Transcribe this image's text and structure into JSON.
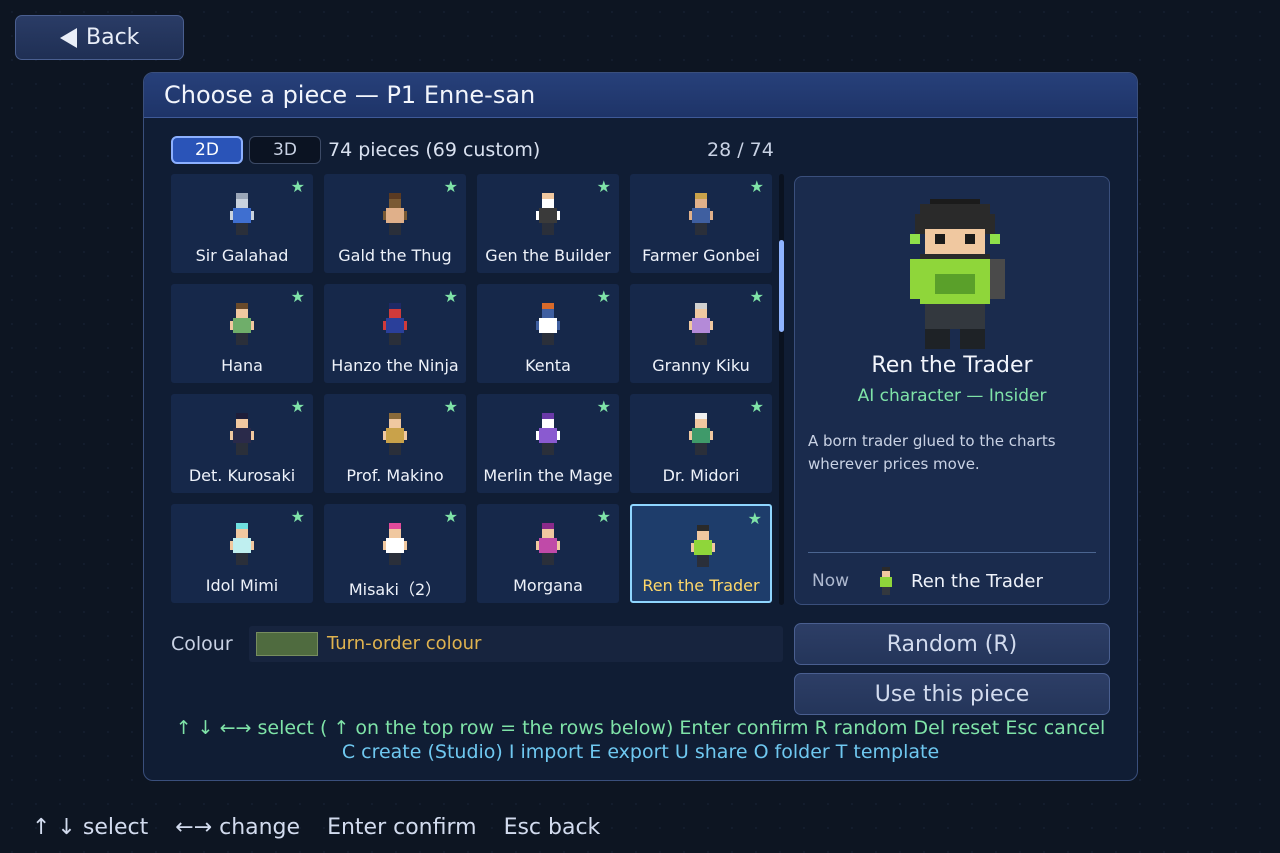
{
  "back_button": {
    "label": "Back"
  },
  "panel": {
    "title": "Choose a piece — P1 Enne-san",
    "modes": [
      "2D",
      "3D"
    ],
    "active_mode": "2D",
    "count_text": "74 pieces (69 custom)",
    "page_index": "28 / 74"
  },
  "pieces": [
    {
      "name": "Sir Galahad",
      "starred": true
    },
    {
      "name": "Gald the Thug",
      "starred": true
    },
    {
      "name": "Gen the Builder",
      "starred": true
    },
    {
      "name": "Farmer Gonbei",
      "starred": true
    },
    {
      "name": "Hana",
      "starred": true
    },
    {
      "name": "Hanzo the Ninja",
      "starred": true
    },
    {
      "name": "Kenta",
      "starred": true
    },
    {
      "name": "Granny Kiku",
      "starred": true
    },
    {
      "name": "Det. Kurosaki",
      "starred": true
    },
    {
      "name": "Prof. Makino",
      "starred": true
    },
    {
      "name": "Merlin the Mage",
      "starred": true
    },
    {
      "name": "Dr. Midori",
      "starred": true
    },
    {
      "name": "Idol Mimi",
      "starred": true
    },
    {
      "name": "Misaki（2）",
      "starred": true
    },
    {
      "name": "Morgana",
      "starred": true
    },
    {
      "name": "Ren the Trader",
      "starred": true,
      "selected": true
    }
  ],
  "star_glyph": "★",
  "detail": {
    "name": "Ren the Trader",
    "subtitle": "AI character — Insider",
    "description": "A born trader glued to the charts wherever prices move.",
    "now_label": "Now",
    "now_name": "Ren the Trader"
  },
  "colour": {
    "label": "Colour",
    "value_text": "Turn-order colour",
    "swatch": "#4f6b3f"
  },
  "buttons": {
    "random": "Random (R)",
    "use": "Use this piece"
  },
  "help": {
    "line1": "↑ ↓ ←→ select ( ↑  on the top row = the rows below)  Enter confirm  R random  Del reset  Esc cancel",
    "line2": "C create (Studio)  I import  E export  U share  O folder  T template"
  },
  "footer": [
    "↑ ↓  select",
    "←→ change",
    "Enter confirm",
    "Esc back"
  ],
  "colors": {
    "accent": "#2a54b8",
    "selected_border": "#8fd6ff",
    "star": "#7fe3a8",
    "highlight_text": "#ffd86a"
  }
}
